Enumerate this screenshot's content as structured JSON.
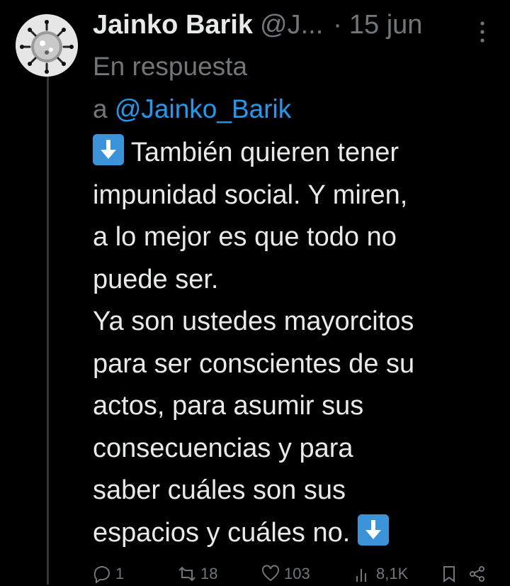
{
  "tweet": {
    "author": {
      "display_name": "Jainko Barik",
      "handle": "@J...",
      "avatar_icon": "spiked-sphere-avatar"
    },
    "separator": "·",
    "date": "15 jun",
    "more_icon": "more-vertical-icon",
    "reply_context": {
      "prefix": "En respuesta",
      "prefix_a": "a",
      "mention": "@Jainko_Barik"
    },
    "text_lines": [
      "También quieren tener",
      "impunidad social. Y miren,",
      "a lo mejor es que todo no",
      "puede ser.",
      "Ya son ustedes mayorcitos",
      "para ser conscientes de su",
      "actos, para asumir sus",
      "consecuencias y para",
      "saber cuáles son sus",
      "espacios y cuáles no."
    ],
    "emoji": "down-arrow-emoji",
    "actions": {
      "replies": "1",
      "retweets": "18",
      "likes": "103",
      "views": "8,1K"
    }
  },
  "colors": {
    "background": "#000000",
    "text": "#e7e9ea",
    "secondary": "#71767b",
    "accent": "#1d9bf0",
    "emoji_blue": "#3b94d9"
  }
}
